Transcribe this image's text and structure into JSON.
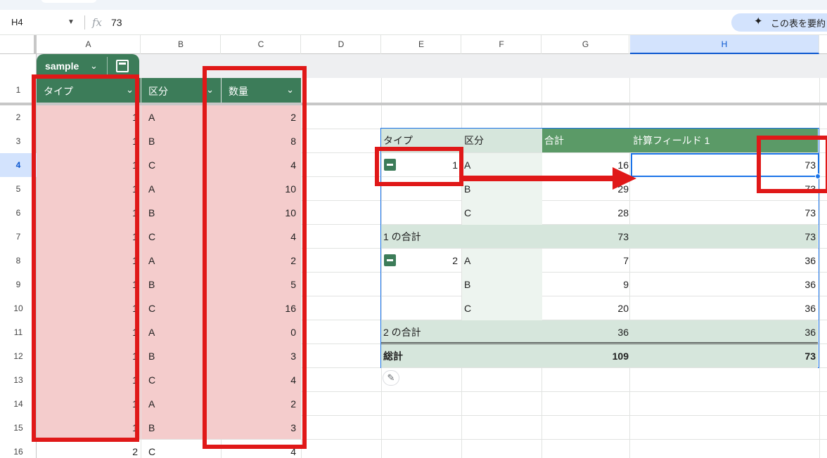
{
  "formula_bar": {
    "cell_ref": "H4",
    "fx_icon": "fx-icon",
    "value": "73",
    "summary_button_label": "この表を要約"
  },
  "columns": [
    "A",
    "B",
    "C",
    "D",
    "E",
    "F",
    "G",
    "H"
  ],
  "selected_column": "H",
  "row_numbers": [
    "1",
    "2",
    "3",
    "4",
    "5",
    "6",
    "7",
    "8",
    "9",
    "10",
    "11",
    "12",
    "13",
    "14",
    "15",
    "16"
  ],
  "selected_row": "4",
  "table": {
    "name": "sample",
    "headers": [
      "タイプ",
      "区分",
      "数量"
    ],
    "rows": [
      [
        "1",
        "A",
        "2"
      ],
      [
        "1",
        "B",
        "8"
      ],
      [
        "1",
        "C",
        "4"
      ],
      [
        "1",
        "A",
        "10"
      ],
      [
        "1",
        "B",
        "10"
      ],
      [
        "1",
        "C",
        "4"
      ],
      [
        "1",
        "A",
        "2"
      ],
      [
        "1",
        "B",
        "5"
      ],
      [
        "1",
        "C",
        "16"
      ],
      [
        "1",
        "A",
        "0"
      ],
      [
        "1",
        "B",
        "3"
      ],
      [
        "1",
        "C",
        "4"
      ],
      [
        "1",
        "A",
        "2"
      ],
      [
        "1",
        "B",
        "3"
      ],
      [
        "2",
        "C",
        "4"
      ]
    ]
  },
  "pivot": {
    "headers": [
      "タイプ",
      "区分",
      "合計",
      "計算フィールド 1"
    ],
    "rows": [
      [
        "1",
        "A",
        "16",
        "73"
      ],
      [
        "",
        "B",
        "29",
        "73"
      ],
      [
        "",
        "C",
        "28",
        "73"
      ],
      [
        "1 の合計",
        "",
        "73",
        "73"
      ],
      [
        "2",
        "A",
        "7",
        "36"
      ],
      [
        "",
        "B",
        "9",
        "36"
      ],
      [
        "",
        "C",
        "20",
        "36"
      ],
      [
        "2 の合計",
        "",
        "36",
        "36"
      ],
      [
        "総計",
        "",
        "109",
        "73"
      ]
    ]
  },
  "colors": {
    "header_green": "#3c7c59",
    "pivot_header_green": "#5b9a67",
    "pivot_subtotal": "#d6e6dc",
    "pivot_label_col": "#edf4ef",
    "highlight_pink": "#f4cccc",
    "annotation_red": "#e01818",
    "selection_blue": "#1a73e8"
  }
}
